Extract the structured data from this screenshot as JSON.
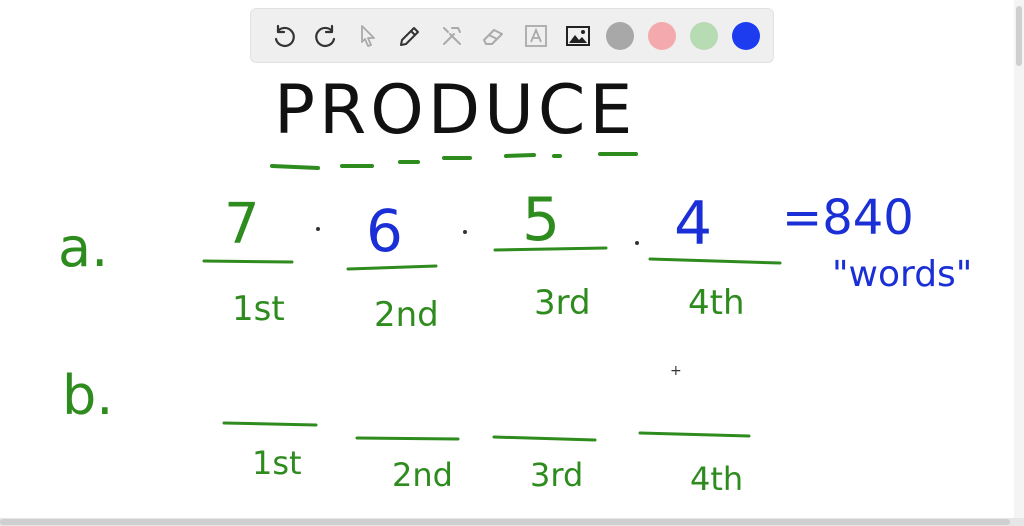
{
  "toolbar": {
    "tools": [
      {
        "name": "undo-icon",
        "enabled": true
      },
      {
        "name": "redo-icon",
        "enabled": true
      },
      {
        "name": "select-pointer-icon",
        "enabled": false
      },
      {
        "name": "pen-icon",
        "enabled": true
      },
      {
        "name": "tools-icon",
        "enabled": false
      },
      {
        "name": "eraser-icon",
        "enabled": false
      },
      {
        "name": "text-box-icon",
        "enabled": false
      },
      {
        "name": "image-icon",
        "enabled": true
      }
    ],
    "colors": [
      "#a8a8a8",
      "#f3a9ad",
      "#b7dcb4",
      "#1d3cf0"
    ],
    "selected_color": "#1d3cf0"
  },
  "canvas": {
    "title": "PRODUCE",
    "part_a_label": "a.",
    "part_b_label": "b.",
    "part_a_factors": [
      "7",
      "6",
      "5",
      "4"
    ],
    "slot_labels": [
      "1st",
      "2nd",
      "3rd",
      "4th"
    ],
    "result": "=840",
    "result_note": "\"words\"",
    "colors": {
      "ink": "#111111",
      "green": "#2e8b1e",
      "blue": "#1a2fd6"
    }
  }
}
